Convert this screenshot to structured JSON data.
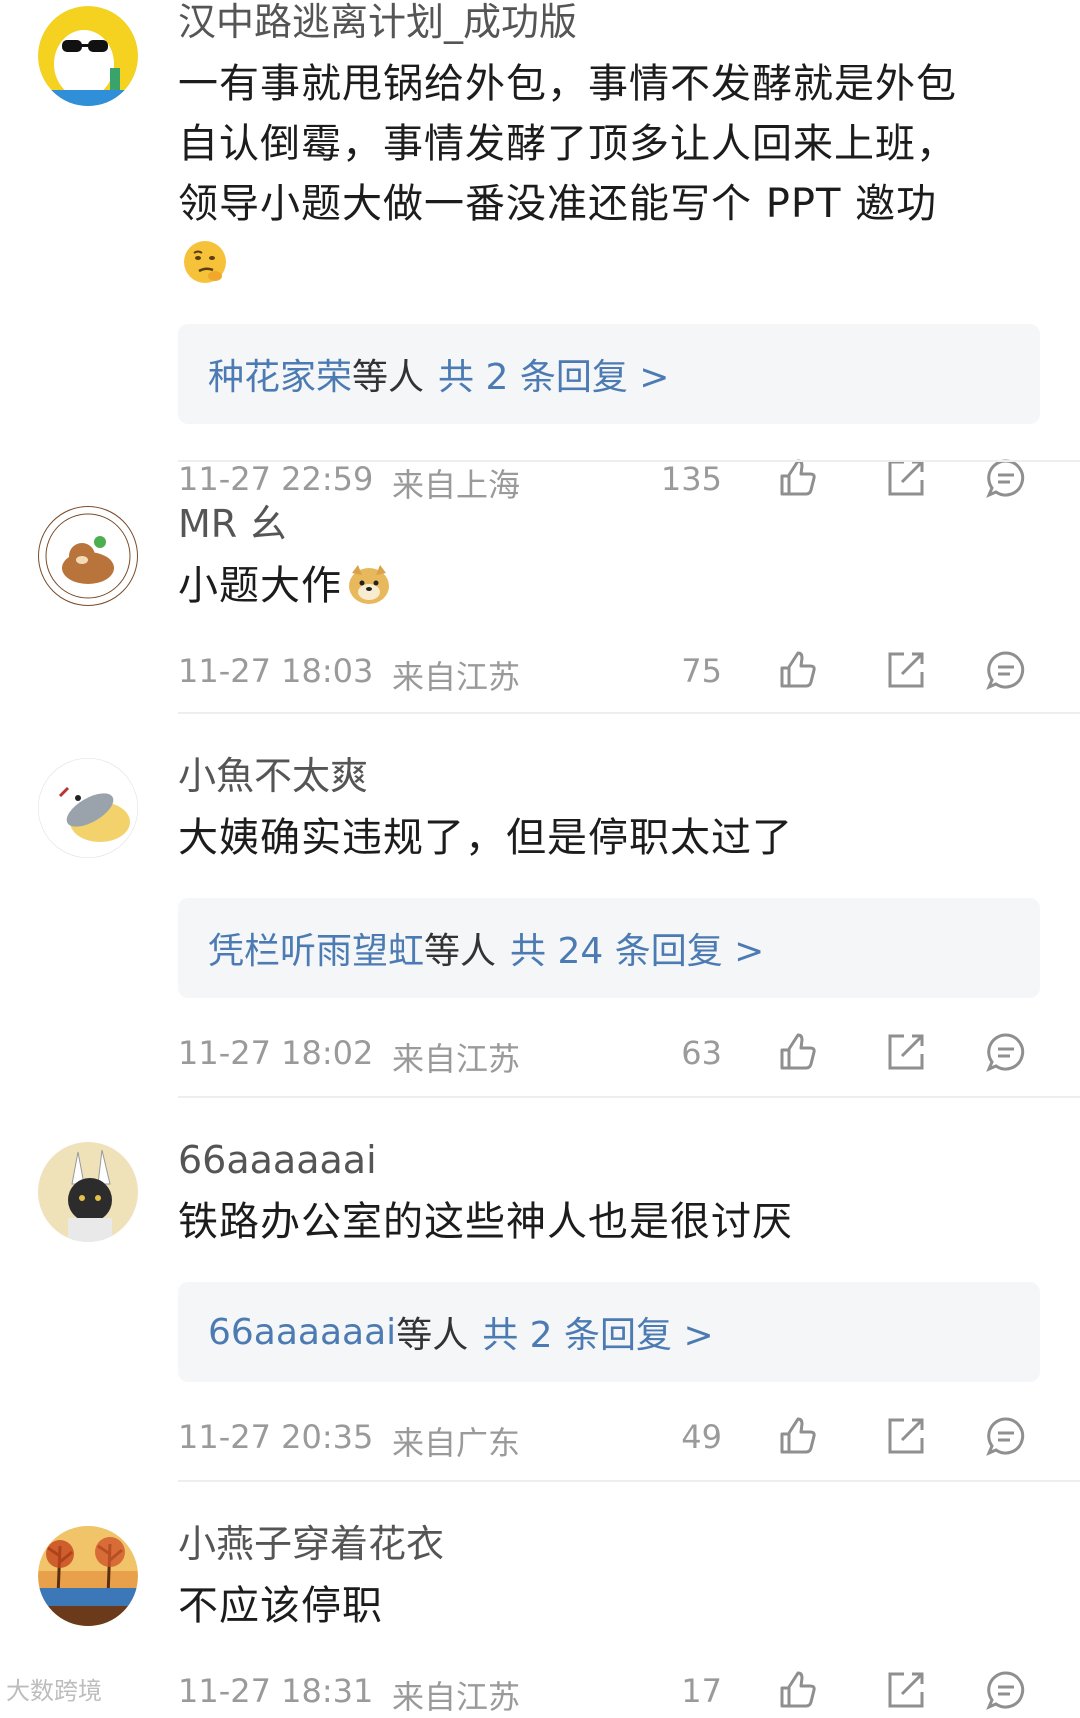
{
  "comments": [
    {
      "username": "汉中路逃离计划_成功版",
      "text": "一有事就甩锅给外包，事情不发酵就是外包自认倒霉，事情发酵了顶多让人回来上班，领导小题大做一番没准还能写个 PPT 邀功",
      "emoji": "thinking-emoji",
      "replies": {
        "who": "种花家荣",
        "etc": "等人",
        "count": "共 2 条回复 >"
      },
      "time": "11-27 22:59",
      "location": "来自上海",
      "likes": "135"
    },
    {
      "username": "MR 幺",
      "text": "小题大作",
      "emoji": "doge-emoji",
      "replies": null,
      "time": "11-27 18:03",
      "location": "来自江苏",
      "likes": "75"
    },
    {
      "username": "小魚不太爽",
      "text": "大姨确实违规了，但是停职太过了",
      "emoji": null,
      "replies": {
        "who": "凭栏听雨望虹",
        "etc": "等人",
        "count": "共 24 条回复 >"
      },
      "time": "11-27 18:02",
      "location": "来自江苏",
      "likes": "63"
    },
    {
      "username": "66aaaaaai",
      "text": "铁路办公室的这些神人也是很讨厌",
      "emoji": null,
      "replies": {
        "who": "66aaaaaai",
        "etc": "等人",
        "count": "共 2 条回复 >"
      },
      "time": "11-27 20:35",
      "location": "来自广东",
      "likes": "49"
    },
    {
      "username": "小燕子穿着花衣",
      "text": "不应该停职",
      "emoji": null,
      "replies": null,
      "time": "11-27 18:31",
      "location": "来自江苏",
      "likes": "17"
    }
  ],
  "watermark": "大数跨境",
  "colors": {
    "link": "#4b7bb2",
    "meta": "#9a9a9a",
    "reply_bg": "#f5f6f8"
  }
}
